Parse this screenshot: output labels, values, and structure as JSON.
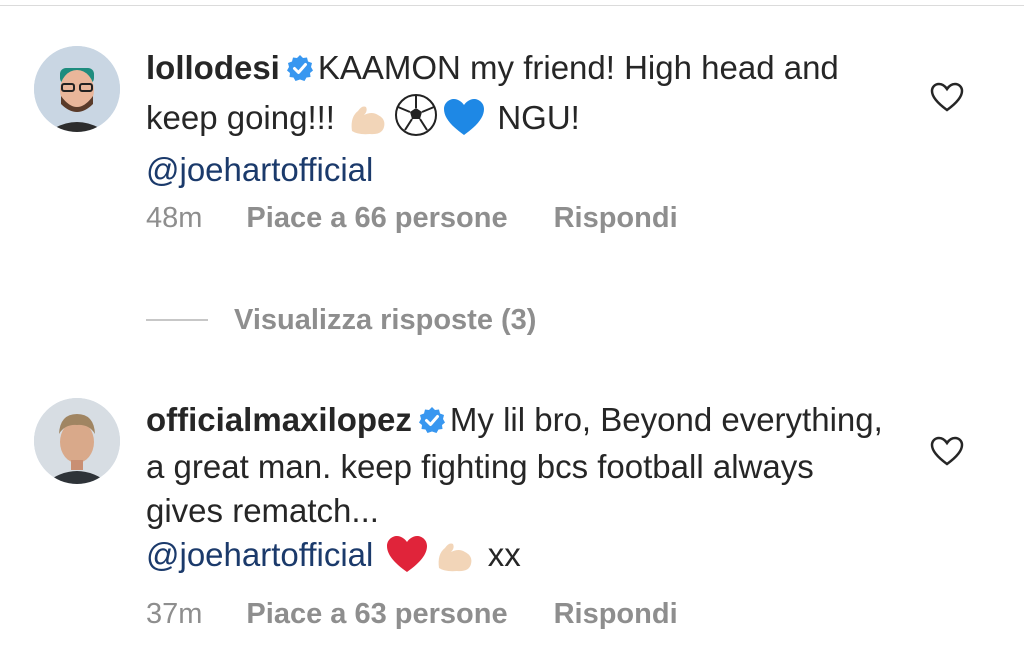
{
  "comments": [
    {
      "username": "lollodesi",
      "text_parts": {
        "intro": "KAAMON my friend! High head and keep going!!!",
        "outro": "NGU!",
        "mention": "@joehartofficial"
      },
      "emojis": [
        "flexed-biceps",
        "soccer-ball",
        "blue-heart"
      ],
      "time": "48m",
      "likes": "Piace a 66 persone",
      "reply": "Rispondi"
    },
    {
      "username": "officialmaxilopez",
      "text_parts": {
        "intro": "My lil bro, Beyond everything, a great man. keep fighting bcs football always gives rematch...",
        "mention": "@joehartofficial",
        "outro": "xx"
      },
      "emojis": [
        "red-heart",
        "flexed-biceps"
      ],
      "time": "37m",
      "likes": "Piace a 63 persone",
      "reply": "Rispondi"
    }
  ],
  "view_replies": "Visualizza risposte (3)",
  "colors": {
    "text": "#262626",
    "secondary": "#8e8e8e",
    "mention": "#1b3a6b",
    "verified": "#3897f0",
    "divider": "#dbdbdb"
  }
}
